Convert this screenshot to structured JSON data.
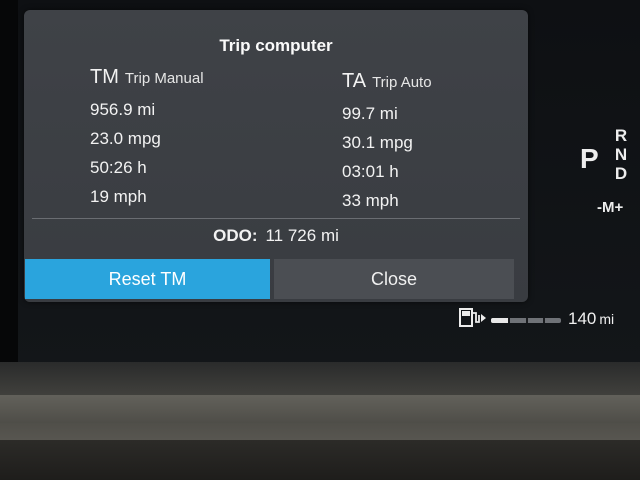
{
  "trip_computer": {
    "title": "Trip computer",
    "manual": {
      "abbr": "TM",
      "label": "Trip Manual",
      "distance": "956.9 mi",
      "economy": "23.0 mpg",
      "time": "50:26 h",
      "speed": "19 mph"
    },
    "auto": {
      "abbr": "TA",
      "label": "Trip Auto",
      "distance": "99.7 mi",
      "economy": "30.1 mpg",
      "time": "03:01 h",
      "speed": "33 mph"
    },
    "odo": {
      "label": "ODO:",
      "value": "11 726 mi"
    },
    "buttons": {
      "reset": "Reset TM",
      "close": "Close"
    }
  },
  "gear": {
    "current": "P",
    "list": [
      "R",
      "N",
      "D"
    ],
    "manual": "-M+"
  },
  "fuel": {
    "icon": "fuel-pump-icon",
    "level": 0.25,
    "range": "140",
    "range_unit": "mi"
  },
  "colors": {
    "accent": "#2aa4dd",
    "popup_bg": "#3f4247",
    "close_bg": "#4b4e53"
  }
}
